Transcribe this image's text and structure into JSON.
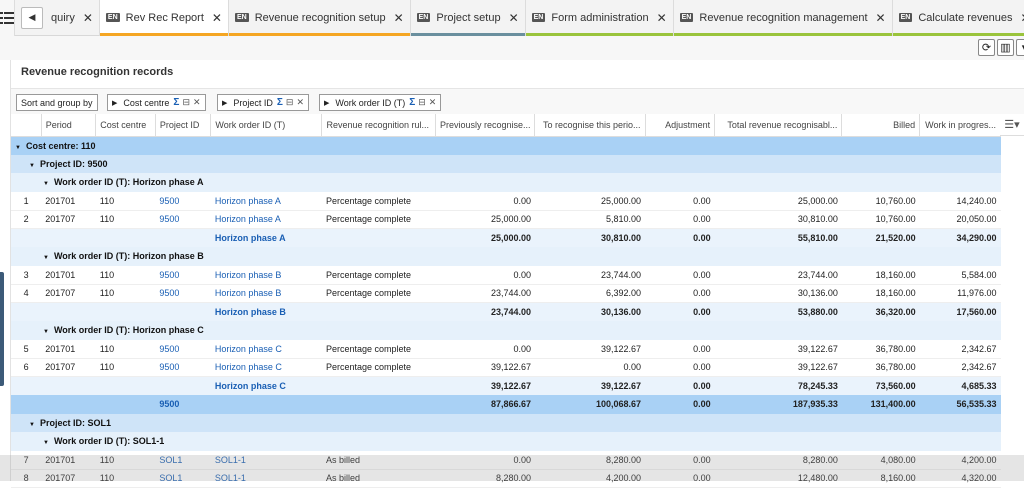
{
  "tabs": [
    {
      "label": "quiry",
      "en": false,
      "active": false,
      "bar": ""
    },
    {
      "label": "Rev Rec Report",
      "en": true,
      "active": true,
      "bar": "#f5a623"
    },
    {
      "label": "Revenue recognition setup",
      "en": true,
      "active": false,
      "bar": "#f5a623"
    },
    {
      "label": "Project setup",
      "en": true,
      "active": false,
      "bar": "#6a8f9e"
    },
    {
      "label": "Form administration",
      "en": true,
      "active": false,
      "bar": "#9ac43c"
    },
    {
      "label": "Revenue recognition management",
      "en": true,
      "active": false,
      "bar": "#9ac43c"
    },
    {
      "label": "Calculate revenues",
      "en": true,
      "active": false,
      "bar": "#9ac43c"
    }
  ],
  "en_label": "EN",
  "panel_title": "Revenue recognition records",
  "group_buttons": {
    "sort_group": "Sort and group by",
    "cost_centre": "Cost centre",
    "project_id": "Project ID",
    "work_order": "Work order ID (T)"
  },
  "columns": [
    "",
    "Period",
    "Cost centre",
    "Project ID",
    "Work order ID (T)",
    "Revenue recognition rul...",
    "Previously recognise...",
    "To recognise this perio...",
    "Adjustment",
    "Total revenue recognisabl...",
    "Billed",
    "Work in progres..."
  ],
  "rows": [
    {
      "type": "grp1",
      "label": "Cost centre: 110"
    },
    {
      "type": "grp2",
      "label": "Project ID: 9500"
    },
    {
      "type": "grp3",
      "label": "Work order ID (T): Horizon phase A"
    },
    {
      "type": "data",
      "cells": [
        "1",
        "201701",
        "110",
        "9500",
        "Horizon phase A",
        "Percentage complete",
        "0.00",
        "25,000.00",
        "0.00",
        "25,000.00",
        "10,760.00",
        "14,240.00"
      ]
    },
    {
      "type": "data",
      "cells": [
        "2",
        "201707",
        "110",
        "9500",
        "Horizon phase A",
        "Percentage complete",
        "25,000.00",
        "5,810.00",
        "0.00",
        "30,810.00",
        "10,760.00",
        "20,050.00"
      ]
    },
    {
      "type": "sub",
      "cells": [
        "",
        "",
        "",
        "",
        "Horizon phase A",
        "",
        "25,000.00",
        "30,810.00",
        "0.00",
        "55,810.00",
        "21,520.00",
        "34,290.00"
      ]
    },
    {
      "type": "grp3",
      "label": "Work order ID (T): Horizon phase B"
    },
    {
      "type": "data",
      "cells": [
        "3",
        "201701",
        "110",
        "9500",
        "Horizon phase B",
        "Percentage complete",
        "0.00",
        "23,744.00",
        "0.00",
        "23,744.00",
        "18,160.00",
        "5,584.00"
      ]
    },
    {
      "type": "data",
      "cells": [
        "4",
        "201707",
        "110",
        "9500",
        "Horizon phase B",
        "Percentage complete",
        "23,744.00",
        "6,392.00",
        "0.00",
        "30,136.00",
        "18,160.00",
        "11,976.00"
      ]
    },
    {
      "type": "sub",
      "cells": [
        "",
        "",
        "",
        "",
        "Horizon phase B",
        "",
        "23,744.00",
        "30,136.00",
        "0.00",
        "53,880.00",
        "36,320.00",
        "17,560.00"
      ]
    },
    {
      "type": "grp3",
      "label": "Work order ID (T): Horizon phase C"
    },
    {
      "type": "data",
      "cells": [
        "5",
        "201701",
        "110",
        "9500",
        "Horizon phase C",
        "Percentage complete",
        "0.00",
        "39,122.67",
        "0.00",
        "39,122.67",
        "36,780.00",
        "2,342.67"
      ]
    },
    {
      "type": "data",
      "cells": [
        "6",
        "201707",
        "110",
        "9500",
        "Horizon phase C",
        "Percentage complete",
        "39,122.67",
        "0.00",
        "0.00",
        "39,122.67",
        "36,780.00",
        "2,342.67"
      ]
    },
    {
      "type": "sub",
      "cells": [
        "",
        "",
        "",
        "",
        "Horizon phase C",
        "",
        "39,122.67",
        "39,122.67",
        "0.00",
        "78,245.33",
        "73,560.00",
        "4,685.33"
      ]
    },
    {
      "type": "tot",
      "cells": [
        "",
        "",
        "",
        "9500",
        "",
        "",
        "87,866.67",
        "100,068.67",
        "0.00",
        "187,935.33",
        "131,400.00",
        "56,535.33"
      ]
    },
    {
      "type": "grp2",
      "label": "Project ID: SOL1"
    },
    {
      "type": "grp3",
      "label": "Work order ID (T): SOL1-1"
    },
    {
      "type": "data",
      "cells": [
        "7",
        "201701",
        "110",
        "SOL1",
        "SOL1-1",
        "As billed",
        "0.00",
        "8,280.00",
        "0.00",
        "8,280.00",
        "4,080.00",
        "4,200.00"
      ]
    },
    {
      "type": "data",
      "cells": [
        "8",
        "201707",
        "110",
        "SOL1",
        "SOL1-1",
        "As billed",
        "8,280.00",
        "4,200.00",
        "0.00",
        "12,480.00",
        "8,160.00",
        "4,320.00"
      ]
    }
  ],
  "colors": {
    "header_group": "#a9d1f5",
    "link": "#1a5fb4"
  }
}
